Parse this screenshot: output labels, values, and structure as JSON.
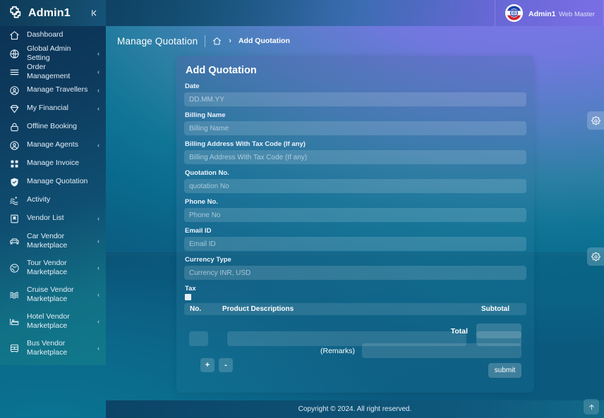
{
  "brand": {
    "title": "Admin1",
    "logo_icon": "hospital-cross-icon",
    "collapse_icon": "collapse-left-icon"
  },
  "user": {
    "name": "Admin1",
    "role": "Web Master",
    "avatar_icon": "globe-swoosh-avatar"
  },
  "sidebar": {
    "items": [
      {
        "label": "Dashboard",
        "icon": "home-icon",
        "caret": false
      },
      {
        "label": "Global Admin Setting",
        "icon": "globe-icon",
        "caret": true
      },
      {
        "label": "Order Management",
        "icon": "menu-lines-icon",
        "caret": true
      },
      {
        "label": "Manage Travellers",
        "icon": "user-circle-icon",
        "caret": true
      },
      {
        "label": "My Financial",
        "icon": "diamond-icon",
        "caret": true
      },
      {
        "label": "Offline Booking",
        "icon": "lock-icon",
        "caret": false
      },
      {
        "label": "Manage Agents",
        "icon": "user-circle-icon",
        "caret": true
      },
      {
        "label": "Manage Invoice",
        "icon": "grid-squares-icon",
        "caret": false
      },
      {
        "label": "Manage Quotation",
        "icon": "shield-icon",
        "caret": false
      },
      {
        "label": "Activity",
        "icon": "activity-waves-icon",
        "caret": false
      },
      {
        "label": "Vendor List",
        "icon": "bookmark-icon",
        "caret": true
      },
      {
        "label": "Car Vendor",
        "label2": "Marketplace",
        "icon": "car-icon",
        "caret": true
      },
      {
        "label": "Tour Vendor",
        "label2": "Marketplace",
        "icon": "globe-tour-icon",
        "caret": true
      },
      {
        "label": "Cruise Vendor",
        "label2": "Marketplace",
        "icon": "waves-icon",
        "caret": true
      },
      {
        "label": "Hotel Vendor",
        "label2": "Marketplace",
        "icon": "bed-icon",
        "caret": true
      },
      {
        "label": "Bus Vendor",
        "label2": "Marketplace",
        "icon": "bus-icon",
        "caret": true
      }
    ]
  },
  "breadcrumb": {
    "title": "Manage Quotation",
    "home_icon": "home-icon",
    "separator": "›",
    "current": "Add Quotation"
  },
  "form": {
    "title": "Add Quotation",
    "fields": [
      {
        "label": "Date",
        "placeholder": "DD.MM.YY",
        "value": ""
      },
      {
        "label": "Billing Name",
        "placeholder": "Billing Name",
        "value": ""
      },
      {
        "label": "Billing Address With Tax Code (If any)",
        "placeholder": "Billing Address With Tax Code (If any)",
        "value": ""
      },
      {
        "label": "Quotation No.",
        "placeholder": "quotation No",
        "value": ""
      },
      {
        "label": "Phone No.",
        "placeholder": "Phone No",
        "value": ""
      },
      {
        "label": "Email ID",
        "placeholder": "Email ID",
        "value": ""
      },
      {
        "label": "Currency Type",
        "placeholder": "Currency INR, USD",
        "value": ""
      }
    ],
    "tax": {
      "label": "Tax",
      "checked": false
    },
    "table": {
      "headers": {
        "no": "No.",
        "description": "Product Descriptions",
        "subtotal": "Subtotal"
      },
      "rows": [
        {
          "no": "",
          "description": "",
          "subtotal": ""
        }
      ]
    },
    "row_controls": {
      "add": "+",
      "remove": "-"
    },
    "total": {
      "label": "Total",
      "value": ""
    },
    "remarks": {
      "label": "(Remarks)",
      "value": "",
      "placeholder": ""
    },
    "submit_label": "submit"
  },
  "floating": {
    "gear_top_icon": "gear-icon",
    "gear_bottom_icon": "gear-icon",
    "scroll_top_icon": "arrow-up-icon"
  },
  "footer": {
    "copyright": "Copyright © 2024. All right reserved."
  },
  "colors": {
    "sidebar_top": "#0b3355",
    "sidebar_bottom": "#11798c",
    "accent_purple": "#7b74e8",
    "accent_teal": "#0f7596",
    "footer": "#0d4f72"
  }
}
